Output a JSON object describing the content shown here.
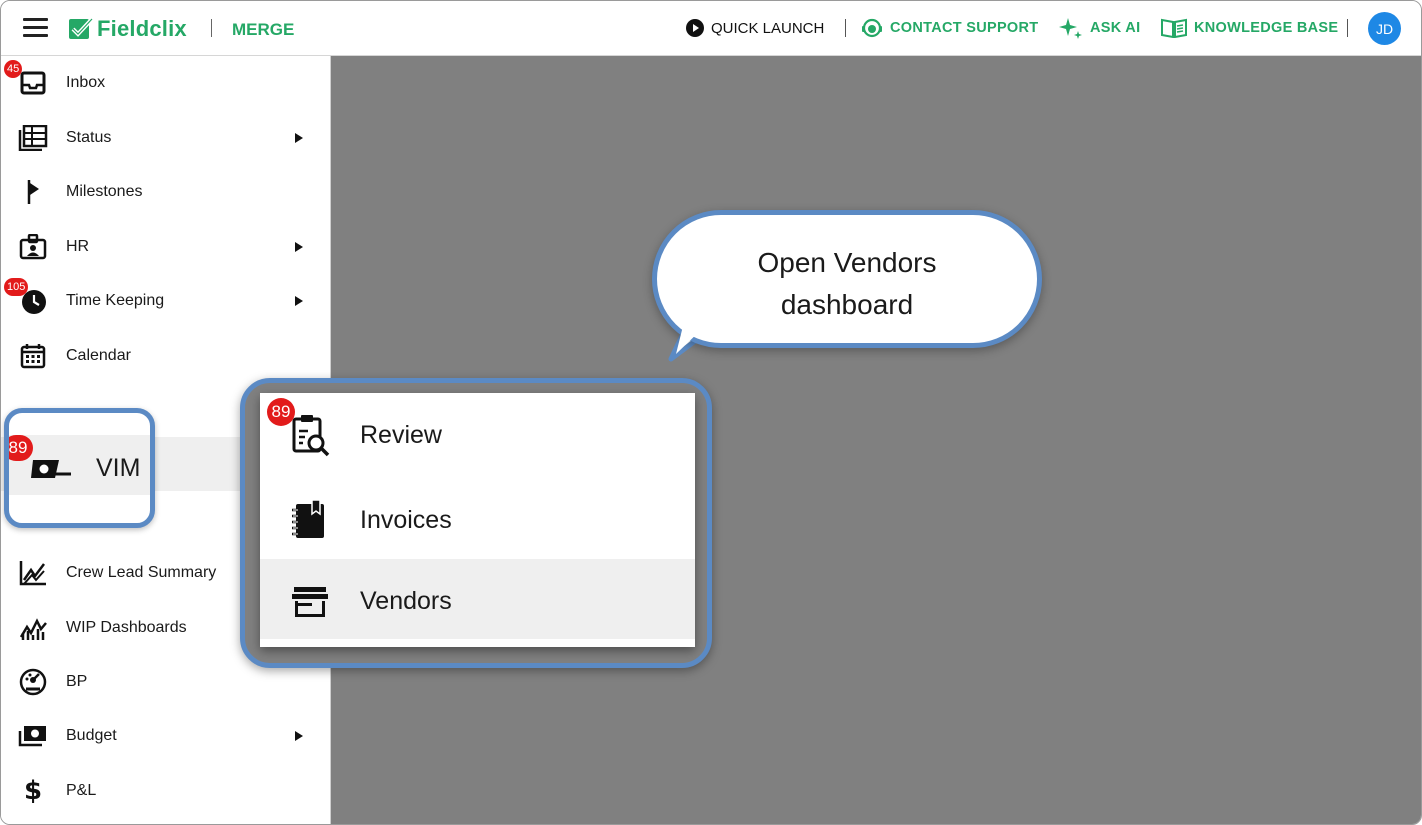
{
  "header": {
    "brand": "Fieldclix",
    "app_name": "MERGE",
    "quick_launch": "QUICK LAUNCH",
    "contact_support": "CONTACT SUPPORT",
    "ask_ai": "ASK AI",
    "knowledge_base": "KNOWLEDGE BASE",
    "avatar_initials": "JD"
  },
  "colors": {
    "brand_green": "#25a866",
    "badge_red": "#e21b1b",
    "callout_border": "#5b8ac4",
    "avatar_blue": "#1e88e5",
    "overlay_gray": "#808080"
  },
  "sidebar": {
    "items": [
      {
        "label": "Inbox",
        "icon": "inbox-icon",
        "badge": "45"
      },
      {
        "label": "Status",
        "icon": "table-icon"
      },
      {
        "label": "Milestones",
        "icon": "flag-icon"
      },
      {
        "label": "HR",
        "icon": "badge-icon"
      },
      {
        "label": "Time Keeping",
        "icon": "clock-icon",
        "badge": "105"
      },
      {
        "label": "Calendar",
        "icon": "calendar-icon"
      },
      {
        "label": "VIM",
        "icon": "money-icon",
        "badge": "89"
      },
      {
        "label": "Crew Lead Summary",
        "icon": "line-chart-icon"
      },
      {
        "label": "WIP Dashboards",
        "icon": "trend-icon"
      },
      {
        "label": "BP",
        "icon": "gauge-icon"
      },
      {
        "label": "Budget",
        "icon": "cash-icon"
      },
      {
        "label": "P&L",
        "icon": "dollar-icon"
      }
    ]
  },
  "vim_submenu": {
    "items": [
      {
        "label": "Review",
        "icon": "review-icon",
        "badge": "89"
      },
      {
        "label": "Invoices",
        "icon": "invoices-icon"
      },
      {
        "label": "Vendors",
        "icon": "storefront-icon"
      }
    ]
  },
  "callout": {
    "line1": "Open Vendors",
    "line2": "dashboard"
  }
}
